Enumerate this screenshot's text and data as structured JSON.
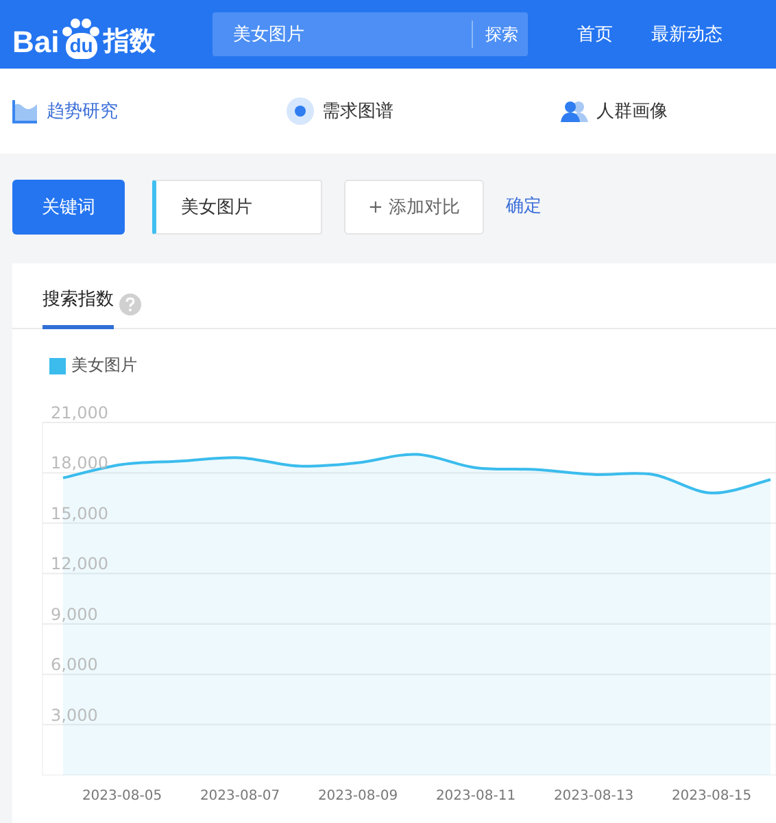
{
  "header": {
    "logo": {
      "left": "Bai",
      "paw": "du",
      "right": "指数"
    },
    "search": {
      "value": "美女图片",
      "button": "探索"
    },
    "nav": [
      "首页",
      "最新动态"
    ]
  },
  "tabs": [
    {
      "label": "趋势研究",
      "selected": true
    },
    {
      "label": "需求图谱",
      "selected": false
    },
    {
      "label": "人群画像",
      "selected": false
    }
  ],
  "keyword_bar": {
    "label": "关键词",
    "keyword": "美女图片",
    "add": "+ 添加对比",
    "confirm": "确定"
  },
  "card": {
    "tab": "搜索指数",
    "chart_data": {
      "type": "line",
      "categories": [
        null,
        "2023-08-05",
        null,
        "2023-08-07",
        null,
        "2023-08-09",
        null,
        "2023-08-11",
        null,
        "2023-08-13",
        null,
        "2023-08-15",
        null
      ],
      "series": [
        {
          "name": "美女图片",
          "color": "#3bbced",
          "values": [
            17700,
            18500,
            18700,
            18900,
            18400,
            18600,
            19100,
            18300,
            18200,
            17900,
            17900,
            16800,
            17600
          ]
        }
      ],
      "ylim": [
        0,
        21000
      ],
      "grid": true,
      "yticks": [
        {
          "value": 3000,
          "label": "3,000"
        },
        {
          "value": 6000,
          "label": "6,000"
        },
        {
          "value": 9000,
          "label": "9,000"
        },
        {
          "value": 12000,
          "label": "12,000"
        },
        {
          "value": 15000,
          "label": "15,000"
        },
        {
          "value": 18000,
          "label": "18,000"
        },
        {
          "value": 21000,
          "label": "21,000"
        }
      ]
    }
  }
}
